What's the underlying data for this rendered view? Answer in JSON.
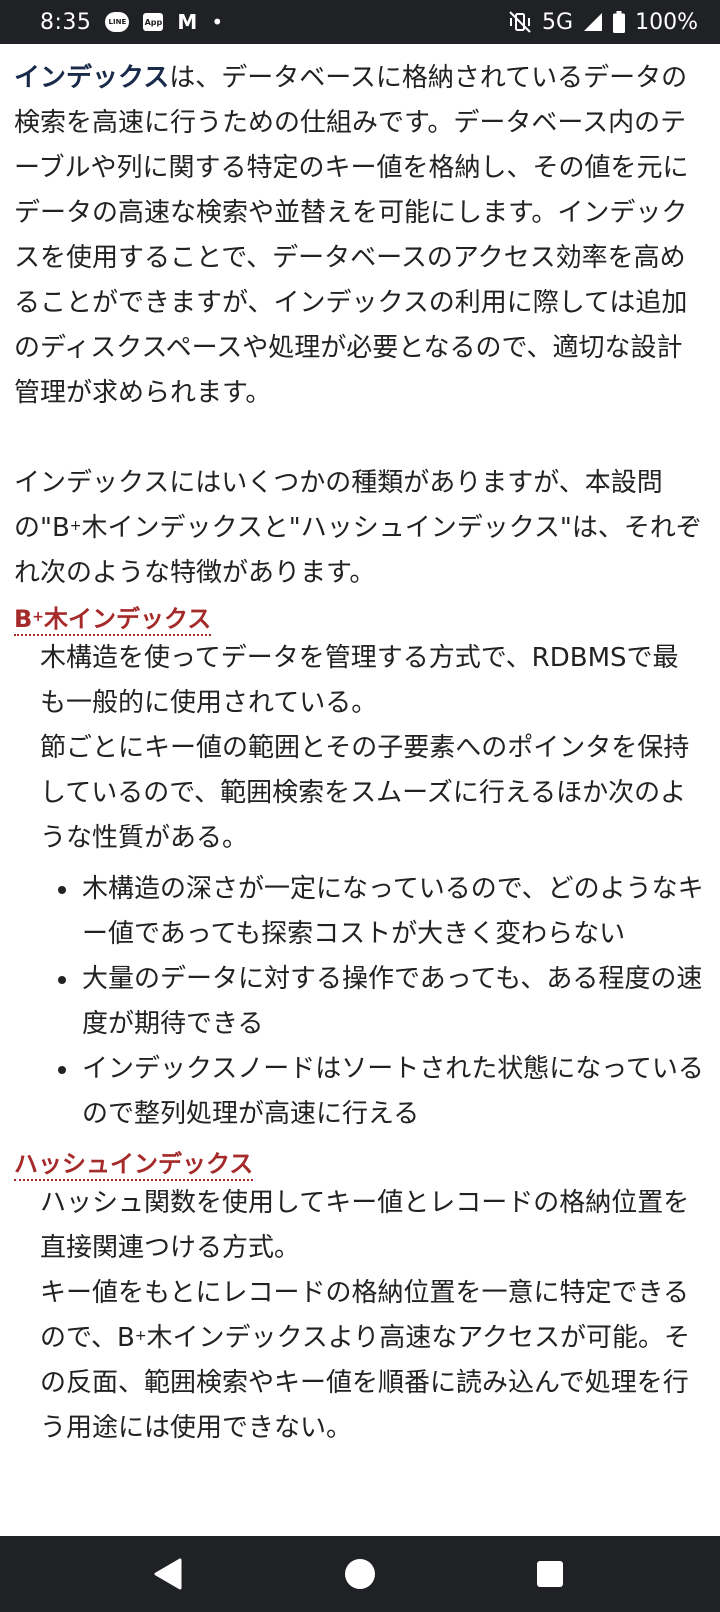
{
  "status_bar": {
    "time": "8:35",
    "notif_line": "LINE",
    "notif_app": "App",
    "notif_mail": "M",
    "notif_dot": "•",
    "network": "5G",
    "battery": "100%"
  },
  "intro": {
    "keyword": "インデックス",
    "p1_rest": "は、データベースに格納されているデータの検索を高速に行うための仕組みです。データベース内のテーブルや列に関する特定のキー値を格納し、その値を元にデータの高速な検索や並替えを可能にします。インデックスを使用することで、データベースのアクセス効率を高めることができますが、インデックスの利用に際しては追加のディスクスペースや処理が必要となるので、適切な設計管理が求められます。",
    "p2_a": "インデックスにはいくつかの種類がありますが、本設問の\"B",
    "p2_sup": "+",
    "p2_b": "木インデックスと\"ハッシュインデックス\"は、それぞれ次のような特徴があります。"
  },
  "btree": {
    "term_b": "B",
    "term_sup": "+",
    "term_rest": "木インデックス",
    "def1": "木構造を使ってデータを管理する方式で、RDBMSで最も一般的に使用されている。",
    "def2": "節ごとにキー値の範囲とその子要素へのポインタを保持しているので、範囲検索をスムーズに行えるほか次のような性質がある。",
    "features": [
      "木構造の深さが一定になっているので、どのようなキー値であっても探索コストが大きく変わらない",
      "大量のデータに対する操作であっても、ある程度の速度が期待できる",
      "インデックスノードはソートされた状態になっているので整列処理が高速に行える"
    ]
  },
  "hash": {
    "term": "ハッシュインデックス",
    "def1": "ハッシュ関数を使用してキー値とレコードの格納位置を直接関連つける方式。",
    "def2_a": "キー値をもとにレコードの格納位置を一意に特定できるので、B",
    "def2_sup": "+",
    "def2_b": "木インデックスより高速なアクセスが可能。その反面、範囲検索やキー値を順番に読み込んで処理を行う用途には使用できない。"
  },
  "colors": {
    "accent_term": "#a52a2a",
    "keyword": "#1a2a4a",
    "bars": "#202124"
  }
}
